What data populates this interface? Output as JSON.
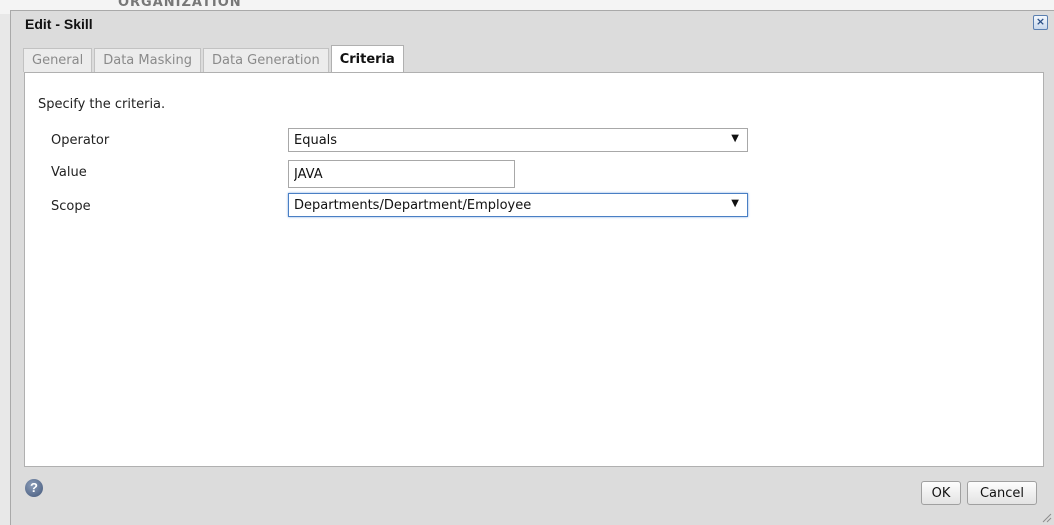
{
  "background": {
    "partial_text": "ORGANIZATION"
  },
  "dialog": {
    "title": "Edit - Skill",
    "close_icon": "close-icon"
  },
  "tabs": [
    {
      "label": "General",
      "active": false
    },
    {
      "label": "Data Masking",
      "active": false
    },
    {
      "label": "Data Generation",
      "active": false
    },
    {
      "label": "Criteria",
      "active": true
    }
  ],
  "criteria": {
    "instruction": "Specify the criteria.",
    "operator": {
      "label": "Operator",
      "value": "Equals"
    },
    "value": {
      "label": "Value",
      "value": "JAVA"
    },
    "scope": {
      "label": "Scope",
      "value": "Departments/Department/Employee"
    }
  },
  "footer": {
    "help_icon": "help-icon",
    "help_glyph": "?",
    "ok_label": "OK",
    "cancel_label": "Cancel"
  },
  "colors": {
    "dialog_bg": "#dcdcdc",
    "panel_bg": "#ffffff",
    "focus_border": "#4a7fc4",
    "help_icon": "#43577a"
  }
}
